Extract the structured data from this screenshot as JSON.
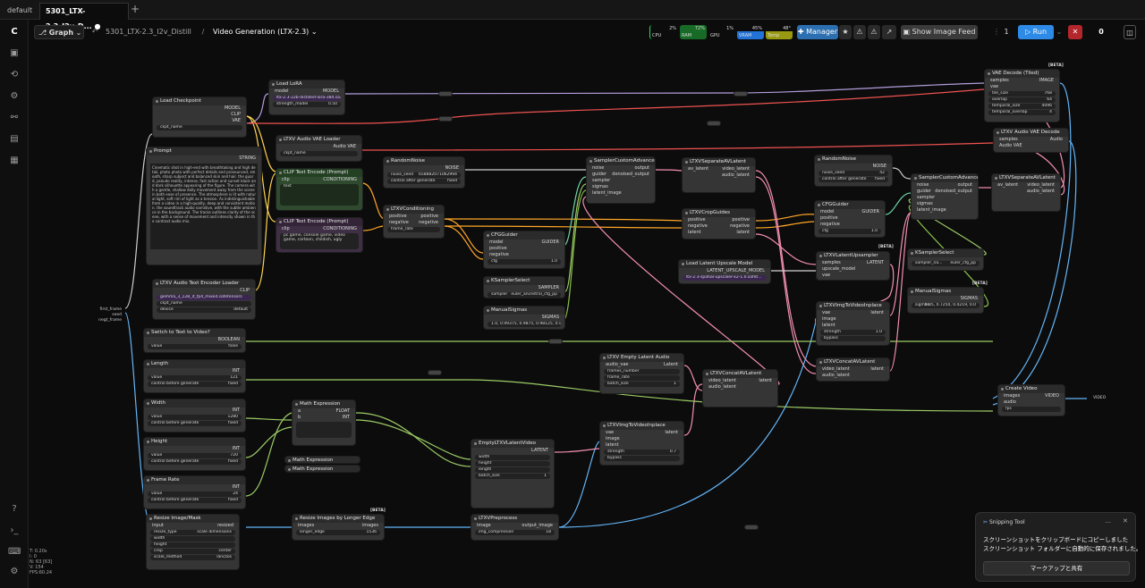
{
  "tabs": {
    "default": "default",
    "active": "5301_LTX-2.3_I2v_D...",
    "dot": "●",
    "plus": "+"
  },
  "toolbar": {
    "mode": "Graph",
    "workflow": "5301_LTX-2.3_I2v_Distill",
    "sep": "/",
    "subgraph": "Video Generation (LTX-2.3)",
    "cpu_label": "CPU",
    "cpu": "2%",
    "ram_label": "RAM",
    "ram": "72%",
    "gpu_label": "GPU",
    "gpu": "1%",
    "vram_label": "VRAM",
    "vram": "45%",
    "temp_label": "Temp",
    "temp": "48°",
    "manager": "Manager",
    "show_feed": "Show Image Feed",
    "queue_count": "1",
    "run": "Run",
    "active": "0 active"
  },
  "nodes": {
    "load_checkpoint": {
      "title": "Load Checkpoint",
      "out1": "MODEL",
      "out2": "CLIP",
      "out3": "VAE",
      "w1": "ckpt_name"
    },
    "load_lora": {
      "title": "Load LoRA",
      "in1": "model",
      "out1": "MODEL",
      "w1": "ltx-2.3-22b-distilled-lora-384.safetensors",
      "w2l": "strength_model",
      "w2v": "0.50"
    },
    "audio_vae": {
      "title": "LTXV Audio VAE Loader",
      "out1": "Audio VAE",
      "w1": "ckpt_name"
    },
    "prompt": {
      "title": "Prompt",
      "out1": "STRING",
      "text": "Cinematic shot in high-end with breathtaking and high detail, photo photo with perfect details and pronounced, smooth, sharp subject and balanced skin and hair. the guard, pseudo reality, intense, fast action and sunset black and dark silhouette appearing of the figure. The camera with a gentle, shallow dolly movement away from the scene in both ease of presence. The atmosphere is lit with natural light, soft rim of light as a tension. As indistinguishable from a video in a high-quality, deep and consistent motion. the soundtrack audio narrative, with the subtle ambience in the background. The tracks outlines clarity of the scene, with a sense of movement and intensity shown in the contrast audio mix."
    },
    "clip_pos": {
      "title": "CLIP Text Encode (Prompt)",
      "in1": "clip",
      "out1": "CONDITIONING",
      "w1": "text"
    },
    "clip_neg": {
      "title": "CLIP Text Encode (Prompt)",
      "in1": "clip",
      "out1": "CONDITIONING",
      "text": "pc game, console game, video game, cartoon, childish, ugly"
    },
    "audio_text": {
      "title": "LTXV Audio Text Encoder Loader",
      "out1": "CLIP",
      "w1": "gemma_3_12B_it_fp4_mixed.safetensors",
      "w2": "ckpt_name",
      "w3l": "device",
      "w3v": "default"
    },
    "random_noise1": {
      "title": "RandomNoise",
      "out1": "NOISE",
      "w1l": "noise_seed",
      "w1v": "658882071062994",
      "w2l": "control after generate",
      "w2v": "fixed"
    },
    "ltxv_cond": {
      "title": "LTXVConditioning",
      "in1": "positive",
      "in2": "negative",
      "out1": "positive",
      "out2": "negative",
      "w1": "frame_rate"
    },
    "cfg_guider1": {
      "title": "CFGGuider",
      "in1": "model",
      "in2": "positive",
      "in3": "negative",
      "out1": "GUIDER",
      "w1l": "cfg",
      "w1v": "1.0"
    },
    "ksampler_select1": {
      "title": "KSamplerSelect",
      "out1": "SAMPLER",
      "w1l": "sampler",
      "w1v": "euler_ancestral_cfg_pp"
    },
    "manual_sigmas1": {
      "title": "ManualSigmas",
      "out1": "SIGMAS",
      "w1": "1.0, 0.99375, 0.9875, 0.98125, 0.975, 0.909375, 0.725, 0.421875, 0.0"
    },
    "sampler_adv1": {
      "title": "SamplerCustomAdvanced",
      "in1": "noise",
      "in2": "guider",
      "in3": "sampler",
      "in4": "sigmas",
      "in5": "latent_image",
      "out1": "output",
      "out2": "denoised_output"
    },
    "separate1": {
      "title": "LTXVSeparateAVLatent",
      "in1": "av_latent",
      "out1": "video_latent",
      "out2": "audio_latent"
    },
    "crop_guides": {
      "title": "LTXVCropGuides",
      "in1": "positive",
      "in2": "negative",
      "in3": "latent",
      "out1": "positive",
      "out2": "negative",
      "out3": "latent"
    },
    "latent_upscale": {
      "title": "Load Latent Upscale Model",
      "out1": "LATENT_UPSCALE_MODEL",
      "w1": "ltx-2.3-spatial-upscaler-x2-1.0.safet..."
    },
    "random_noise2": {
      "title": "RandomNoise",
      "out1": "NOISE",
      "w1l": "noise_seed",
      "w1v": "42",
      "w2l": "control after generate",
      "w2v": "fixed"
    },
    "cfg_guider2": {
      "title": "CFGGuider",
      "in1": "model",
      "in2": "positive",
      "in3": "negative",
      "out1": "GUIDER",
      "w1l": "cfg",
      "w1v": "1.0"
    },
    "latent_upsampler": {
      "title": "LTXVLatentUpsampler",
      "in1": "samples",
      "in2": "upscale_model",
      "in3": "vae",
      "out1": "LATENT",
      "badge": "[BETA]"
    },
    "img_to_video": {
      "title": "LTXVImgToVideoInplace",
      "in1": "vae",
      "in2": "image",
      "in3": "latent",
      "out1": "latent",
      "w1l": "strength",
      "w1v": "1.0",
      "w2": "bypass"
    },
    "concat1": {
      "title": "LTXVConcatAVLatent",
      "in1": "video_latent",
      "in2": "audio_latent",
      "out1": "latent"
    },
    "sampler_adv2": {
      "title": "SamplerCustomAdvanced",
      "in1": "noise",
      "in2": "guider",
      "in3": "sampler",
      "in4": "sigmas",
      "in5": "latent_image",
      "out1": "output",
      "out2": "denoised_output"
    },
    "ksampler_select2": {
      "title": "KSamplerSelect",
      "out1": "SAMPLER",
      "w1l": "sampler_na...",
      "w1v": "euler_cfg_pp"
    },
    "manual_sigmas2": {
      "title": "ManualSigmas",
      "out1": "SIGMAS",
      "w1l": "sigmas",
      "w1v": "0.85, 0.7250, 0.4219, 0.0",
      "badge": "[BETA]"
    },
    "vae_decode_tiled": {
      "title": "VAE Decode (Tiled)",
      "in1": "samples",
      "in2": "vae",
      "out1": "IMAGE",
      "badge": "[BETA]",
      "w1l": "tile_size",
      "w1v": "768",
      "w2l": "overlap",
      "w2v": "64",
      "w3l": "temporal_size",
      "w3v": "4096",
      "w4l": "temporal_overlap",
      "w4v": "4"
    },
    "audio_vae_decode": {
      "title": "LTXV Audio VAE Decode",
      "in1": "samples",
      "in2": "Audio VAE",
      "out1": "Audio"
    },
    "separate2": {
      "title": "LTXVSeparateAVLatent",
      "in1": "av_latent",
      "out1": "video_latent",
      "out2": "audio_latent"
    },
    "switch": {
      "title": "Switch to Text to Video?",
      "out1": "BOOLEAN",
      "w1l": "value",
      "w1v": "false"
    },
    "length": {
      "title": "Length",
      "out1": "INT",
      "w1l": "value",
      "w1v": "121",
      "w2l": "control before generate",
      "w2v": "fixed"
    },
    "width": {
      "title": "Width",
      "out1": "INT",
      "w1l": "value",
      "w1v": "1280",
      "w2l": "control before generate",
      "w2v": "fixed"
    },
    "height": {
      "title": "Height",
      "out1": "INT",
      "w1l": "value",
      "w1v": "720",
      "w2l": "control before generate",
      "w2v": "fixed"
    },
    "frame_rate": {
      "title": "Frame Rate",
      "out1": "INT",
      "w1l": "value",
      "w1v": "24",
      "w2l": "control before generate",
      "w2v": "fixed"
    },
    "math_expr1": {
      "title": "Math Expression",
      "in1": "a",
      "in2": "b",
      "out1": "FLOAT",
      "out2": "INT"
    },
    "math_expr2": {
      "title": "Math Expression"
    },
    "math_expr3": {
      "title": "Math Expression"
    },
    "empty_audio": {
      "title": "LTXV Empty Latent Audio",
      "in1": "audio_vae",
      "out1": "Latent",
      "w1": "frames_number",
      "w2": "frame_rate",
      "w3l": "batch_size",
      "w3v": "1"
    },
    "concat2": {
      "title": "LTXVConcatAVLatent",
      "in1": "video_latent",
      "in2": "audio_latent",
      "out1": "latent"
    },
    "img_to_video2": {
      "title": "LTXVImgToVideoInplace",
      "in1": "vae",
      "in2": "image",
      "in3": "latent",
      "out1": "latent",
      "w1l": "strength",
      "w1v": "0.7",
      "w2": "bypass"
    },
    "empty_latent_video": {
      "title": "EmptyLTXVLatentVideo",
      "out1": "LATENT",
      "w1": "width",
      "w2": "height",
      "w3": "length",
      "w4l": "batch_size",
      "w4v": "1"
    },
    "resize_image": {
      "title": "Resize Image/Mask",
      "in1": "input",
      "out1": "resized",
      "w1l": "resize_type",
      "w1v": "scale dimensions",
      "w2": "width",
      "w3": "height",
      "w4l": "crop",
      "w4v": "center",
      "w5l": "scale_method",
      "w5v": "lanczos"
    },
    "resize_longer": {
      "title": "Resize Images by Longer Edge",
      "in1": "images",
      "out1": "images",
      "w1l": "longer_edge",
      "w1v": "1536",
      "badge": "[BETA]"
    },
    "ltxv_preprocess": {
      "title": "LTXVPreprocess",
      "in1": "image",
      "out1": "output_image",
      "w1l": "img_compression",
      "w1v": "18"
    },
    "create_video": {
      "title": "Create Video",
      "in1": "images",
      "in2": "audio",
      "in3": "fps",
      "out1": "VIDEO"
    },
    "inputs": {
      "a": "first_frame",
      "b": "seed",
      "c": "negt_frame"
    },
    "out_video": "VIDEO"
  },
  "stats": {
    "l1": "T: 0.20s",
    "l2": "I: 0",
    "l3": "N: 63 [63]",
    "l4": "V: 154",
    "l5": "FPS:60.24"
  },
  "toast": {
    "app": "Snipping Tool",
    "line1": "スクリーンショットをクリップボードにコピーしました",
    "line2": "スクリーンショット フォルダーに自動的に保存されました。",
    "button": "マークアップと共有"
  }
}
